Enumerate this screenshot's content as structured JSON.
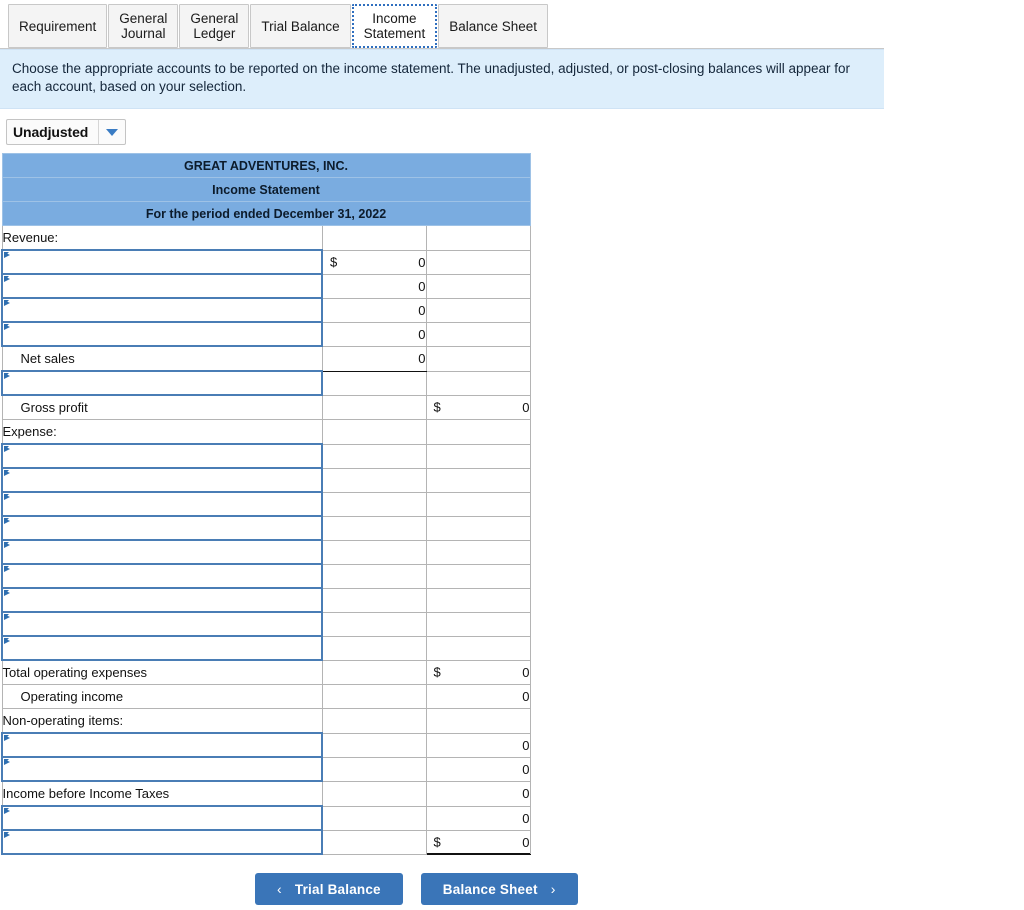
{
  "tabs": [
    {
      "label": "Requirement",
      "active": false
    },
    {
      "label": "General\nJournal",
      "active": false
    },
    {
      "label": "General\nLedger",
      "active": false
    },
    {
      "label": "Trial Balance",
      "active": false
    },
    {
      "label": "Income\nStatement",
      "active": true
    },
    {
      "label": "Balance Sheet",
      "active": false
    }
  ],
  "banner": {
    "text": "Choose the appropriate accounts to be reported on the income statement. The unadjusted, adjusted, or post-closing balances will appear for each account, based on your selection."
  },
  "selector": {
    "value": "Unadjusted",
    "icon": "chevron-down-icon"
  },
  "statement": {
    "title_lines": [
      "GREAT ADVENTURES, INC.",
      "Income Statement",
      "For the period ended December 31, 2022"
    ],
    "rows": [
      {
        "type": "section",
        "label": "Revenue:",
        "c1": "",
        "c2": ""
      },
      {
        "type": "dropdown",
        "label": "",
        "c1": "0",
        "c1_cur": "$",
        "c2": ""
      },
      {
        "type": "dropdown",
        "label": "",
        "c1": "0",
        "c2": ""
      },
      {
        "type": "dropdown",
        "label": "",
        "c1": "0",
        "c2": ""
      },
      {
        "type": "dropdown",
        "label": "",
        "c1": "0",
        "c2": ""
      },
      {
        "type": "subtotal",
        "label": "Net sales",
        "indent": true,
        "c1": "0",
        "c1_rule": "single",
        "c2": ""
      },
      {
        "type": "dropdown",
        "label": "",
        "c1": "",
        "c1_rule": "top",
        "c2": ""
      },
      {
        "type": "subtotal",
        "label": "Gross profit",
        "indent": true,
        "c1": "",
        "c2": "0",
        "c2_cur": "$"
      },
      {
        "type": "section",
        "label": "Expense:",
        "c1": "",
        "c2": ""
      },
      {
        "type": "dropdown",
        "label": "",
        "c1": "",
        "c2": ""
      },
      {
        "type": "dropdown",
        "label": "",
        "c1": "",
        "c2": ""
      },
      {
        "type": "dropdown",
        "label": "",
        "c1": "",
        "c2": ""
      },
      {
        "type": "dropdown",
        "label": "",
        "c1": "",
        "c2": ""
      },
      {
        "type": "dropdown",
        "label": "",
        "c1": "",
        "c2": ""
      },
      {
        "type": "dropdown",
        "label": "",
        "c1": "",
        "c2": ""
      },
      {
        "type": "dropdown",
        "label": "",
        "c1": "",
        "c2": ""
      },
      {
        "type": "dropdown",
        "label": "",
        "c1": "",
        "c2": ""
      },
      {
        "type": "dropdown",
        "label": "",
        "c1": "",
        "c2": ""
      },
      {
        "type": "total",
        "label": "Total operating expenses",
        "c1": "",
        "c2": "0",
        "c2_cur": "$"
      },
      {
        "type": "subtotal",
        "label": "Operating income",
        "indent": true,
        "c1": "",
        "c2": "0",
        "c2_rule": "top"
      },
      {
        "type": "section",
        "label": "Non-operating items:",
        "c1": "",
        "c2": ""
      },
      {
        "type": "dropdown",
        "label": "",
        "c1": "",
        "c2": "0"
      },
      {
        "type": "dropdown",
        "label": "",
        "c1": "",
        "c2": "0"
      },
      {
        "type": "total",
        "label": "Income before Income Taxes",
        "c1": "",
        "c2": "0",
        "c2_rule": "top"
      },
      {
        "type": "dropdown",
        "label": "",
        "c1": "",
        "c2": "0"
      },
      {
        "type": "dropdown",
        "label": "",
        "c1": "",
        "c2": "0",
        "c2_cur": "$",
        "c2_rule": "double"
      }
    ]
  },
  "nav": {
    "prev": {
      "label": "Trial Balance",
      "icon": "chevron-left-icon",
      "glyph": "‹"
    },
    "next": {
      "label": "Balance Sheet",
      "icon": "chevron-right-icon",
      "glyph": "›"
    }
  },
  "colors": {
    "header_blue": "#7aace0",
    "banner_blue": "#ddeefb",
    "button_blue": "#3a75b8",
    "dropdown_border": "#4a7db5"
  }
}
